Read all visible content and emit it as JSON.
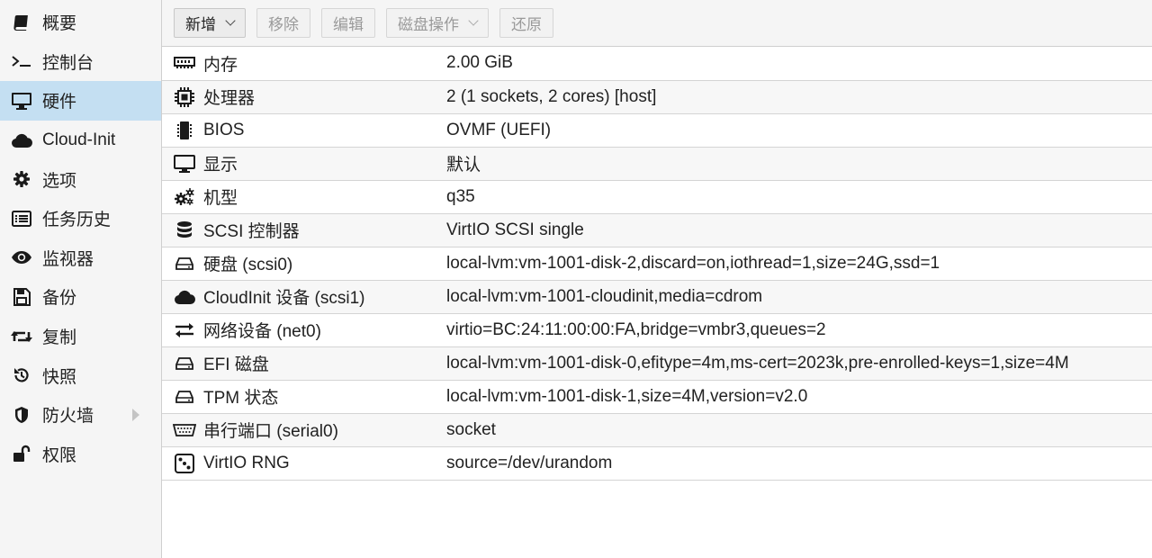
{
  "sidebar": {
    "items": [
      {
        "label": "概要",
        "icon": "book-icon",
        "active": false
      },
      {
        "label": "控制台",
        "icon": "terminal-icon",
        "active": false
      },
      {
        "label": "硬件",
        "icon": "monitor-icon",
        "active": true
      },
      {
        "label": "Cloud-Init",
        "icon": "cloud-icon",
        "active": false
      },
      {
        "label": "选项",
        "icon": "gear-icon",
        "active": false
      },
      {
        "label": "任务历史",
        "icon": "list-icon",
        "active": false
      },
      {
        "label": "监视器",
        "icon": "eye-icon",
        "active": false
      },
      {
        "label": "备份",
        "icon": "floppy-disk-icon",
        "active": false
      },
      {
        "label": "复制",
        "icon": "retweet-icon",
        "active": false
      },
      {
        "label": "快照",
        "icon": "history-icon",
        "active": false
      },
      {
        "label": "防火墙",
        "icon": "shield-icon",
        "active": false,
        "expandable": true
      },
      {
        "label": "权限",
        "icon": "unlock-icon",
        "active": false
      }
    ]
  },
  "toolbar": {
    "add_label": "新增",
    "remove_label": "移除",
    "edit_label": "编辑",
    "disk_action_label": "磁盘操作",
    "revert_label": "还原"
  },
  "hardware": {
    "rows": [
      {
        "icon": "memory-icon",
        "name": "内存",
        "value": "2.00 GiB"
      },
      {
        "icon": "cpu-icon",
        "name": "处理器",
        "value": "2 (1 sockets, 2 cores) [host]"
      },
      {
        "icon": "chip-icon",
        "name": "BIOS",
        "value": "OVMF (UEFI)"
      },
      {
        "icon": "desktop-icon",
        "name": "显示",
        "value": "默认"
      },
      {
        "icon": "cogs-icon",
        "name": "机型",
        "value": "q35"
      },
      {
        "icon": "database-icon",
        "name": "SCSI 控制器",
        "value": "VirtIO SCSI single"
      },
      {
        "icon": "hdd-icon",
        "name": "硬盘 (scsi0)",
        "value": "local-lvm:vm-1001-disk-2,discard=on,iothread=1,size=24G,ssd=1"
      },
      {
        "icon": "cloud-icon",
        "name": "CloudInit 设备 (scsi1)",
        "value": "local-lvm:vm-1001-cloudinit,media=cdrom"
      },
      {
        "icon": "exchange-icon",
        "name": "网络设备 (net0)",
        "value": "virtio=BC:24:11:00:00:FA,bridge=vmbr3,queues=2"
      },
      {
        "icon": "hdd-icon",
        "name": "EFI 磁盘",
        "value": "local-lvm:vm-1001-disk-0,efitype=4m,ms-cert=2023k,pre-enrolled-keys=1,size=4M"
      },
      {
        "icon": "hdd-icon",
        "name": "TPM 状态",
        "value": "local-lvm:vm-1001-disk-1,size=4M,version=v2.0"
      },
      {
        "icon": "serial-port-icon",
        "name": "串行端口 (serial0)",
        "value": "socket"
      },
      {
        "icon": "dice-icon",
        "name": "VirtIO RNG",
        "value": "source=/dev/urandom"
      }
    ]
  }
}
